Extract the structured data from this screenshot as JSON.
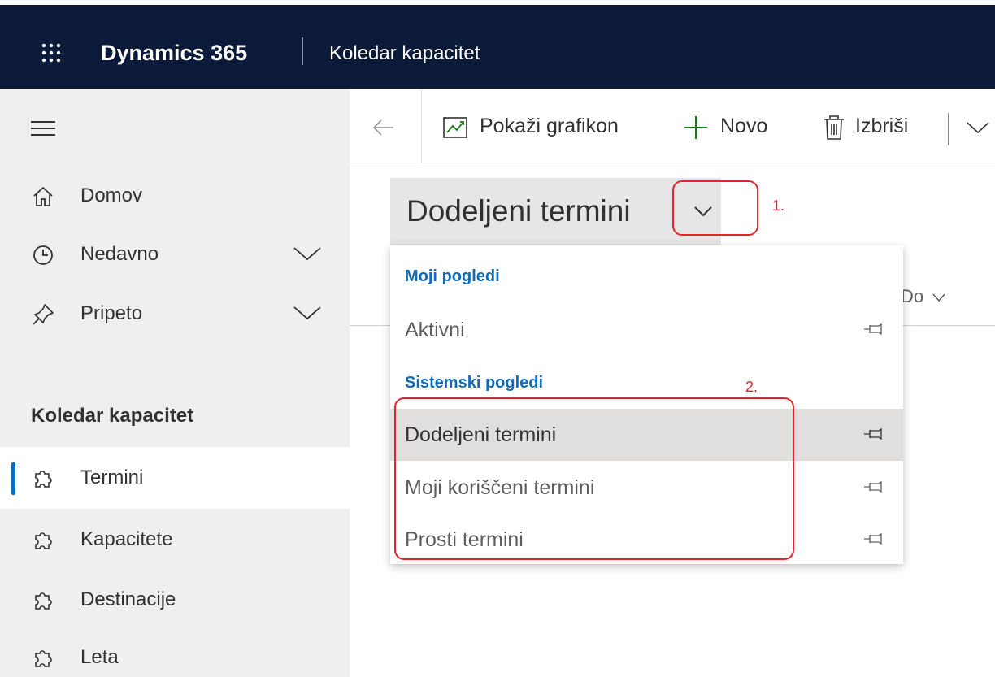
{
  "header": {
    "app_name": "Dynamics 365",
    "area_name": "Koledar kapacitet",
    "waffle_icon": "waffle-icon",
    "background_color": "#0b1a38"
  },
  "sidenav": {
    "menu_icon": "hamburger-icon",
    "items_top": [
      {
        "label": "Domov",
        "icon": "home-icon",
        "expandable": false
      },
      {
        "label": "Nedavno",
        "icon": "clock-icon",
        "expandable": true
      },
      {
        "label": "Pripeto",
        "icon": "pin-icon",
        "expandable": true
      }
    ],
    "section_title": "Koledar kapacitet",
    "entities": [
      {
        "label": "Termini",
        "icon": "puzzle-icon",
        "selected": true
      },
      {
        "label": "Kapacitete",
        "icon": "puzzle-icon",
        "selected": false
      },
      {
        "label": "Destinacije",
        "icon": "puzzle-icon",
        "selected": false
      },
      {
        "label": "Leta",
        "icon": "puzzle-icon",
        "selected": false
      }
    ],
    "selected_accent": "#0f6cbd"
  },
  "commandbar": {
    "back_icon": "arrow-left-icon",
    "show_chart_label": "Pokaži grafikon",
    "new_label": "Novo",
    "delete_label": "Izbriši",
    "new_icon_color": "#107c10"
  },
  "view": {
    "title": "Dodeljeni termini",
    "column_partial_label": "Do"
  },
  "flyout": {
    "my_views_title": "Moji pogledi",
    "my_views": [
      {
        "label": "Aktivni"
      }
    ],
    "system_views_title": "Sistemski pogledi",
    "system_views": [
      {
        "label": "Dodeljeni termini",
        "active": true
      },
      {
        "label": "Moji koriščeni termini",
        "active": false
      },
      {
        "label": "Prosti termini",
        "active": false
      }
    ],
    "group_title_color": "#0f6cbd"
  },
  "annotations": {
    "step1": "1.",
    "step2": "2.",
    "color": "#e3242b"
  }
}
